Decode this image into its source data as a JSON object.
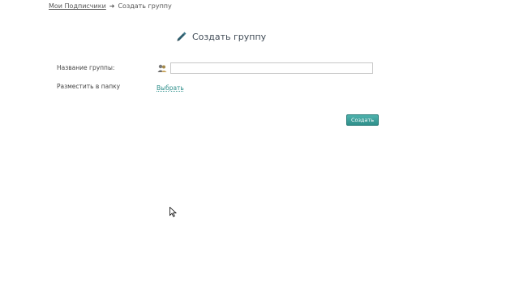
{
  "breadcrumb": {
    "parent_label": "Мои Подписчики",
    "current_label": "Создать группу"
  },
  "page": {
    "title": "Создать группу"
  },
  "form": {
    "name_label": "Название группы:",
    "name_value": "",
    "folder_label": "Разместить в папку",
    "folder_link": "Выбрать",
    "submit_label": "Создать"
  },
  "icons": {
    "title_icon": "pencil-icon",
    "name_icon": "group-icon",
    "cursor": "mouse-pointer-icon"
  },
  "colors": {
    "accent": "#2f8f8a",
    "link": "#2e8f8b"
  }
}
